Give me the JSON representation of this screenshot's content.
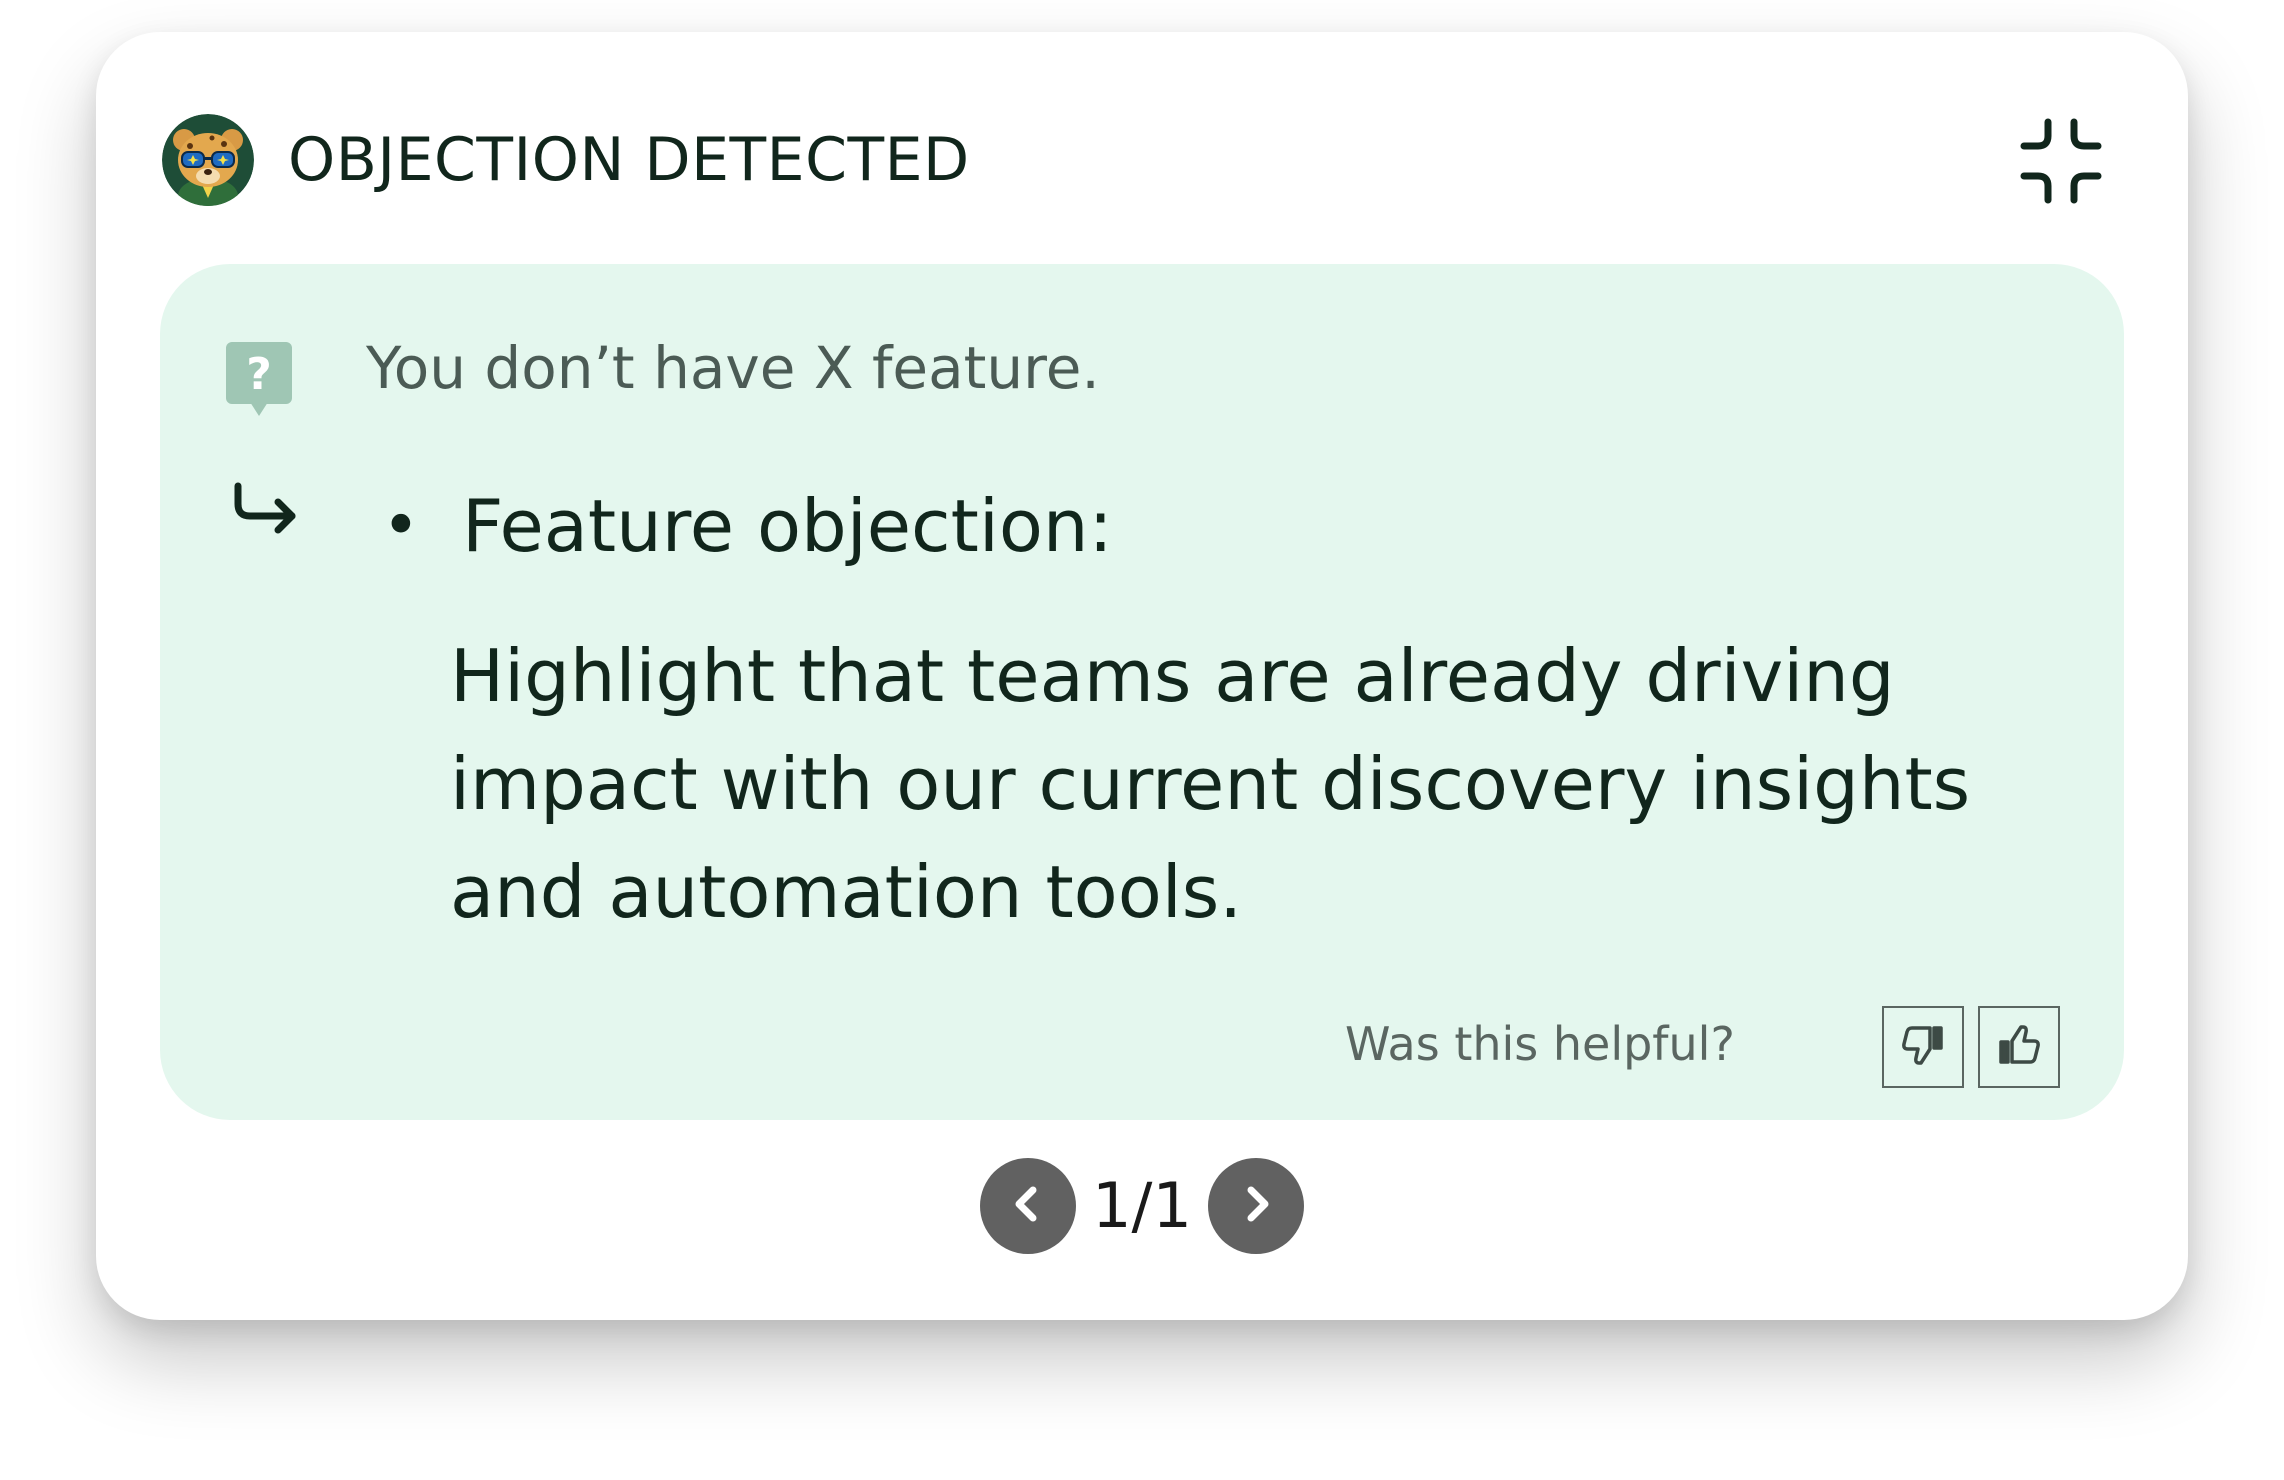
{
  "header": {
    "avatar_icon": "cheetah-mascot-icon",
    "title": "OBJECTION DETECTED",
    "collapse_icon": "collapse-arrows-icon"
  },
  "objection": {
    "question_icon": "question-bubble-icon",
    "question": "You don’t have X feature.",
    "reply_icon": "reply-arrow-icon",
    "bullet_title": "Feature objection:",
    "bullet_body": "Highlight that teams are already driving impact with our current discovery insights and automation tools."
  },
  "feedback": {
    "label": "Was this helpful?",
    "thumbs_down_icon": "thumbs-down-icon",
    "thumbs_up_icon": "thumbs-up-icon"
  },
  "pager": {
    "prev_icon": "chevron-left-icon",
    "next_icon": "chevron-right-icon",
    "count": "1/1"
  },
  "colors": {
    "panel_bg": "#e4f7ee",
    "text_dark": "#11261c",
    "nav_button": "#616161"
  }
}
